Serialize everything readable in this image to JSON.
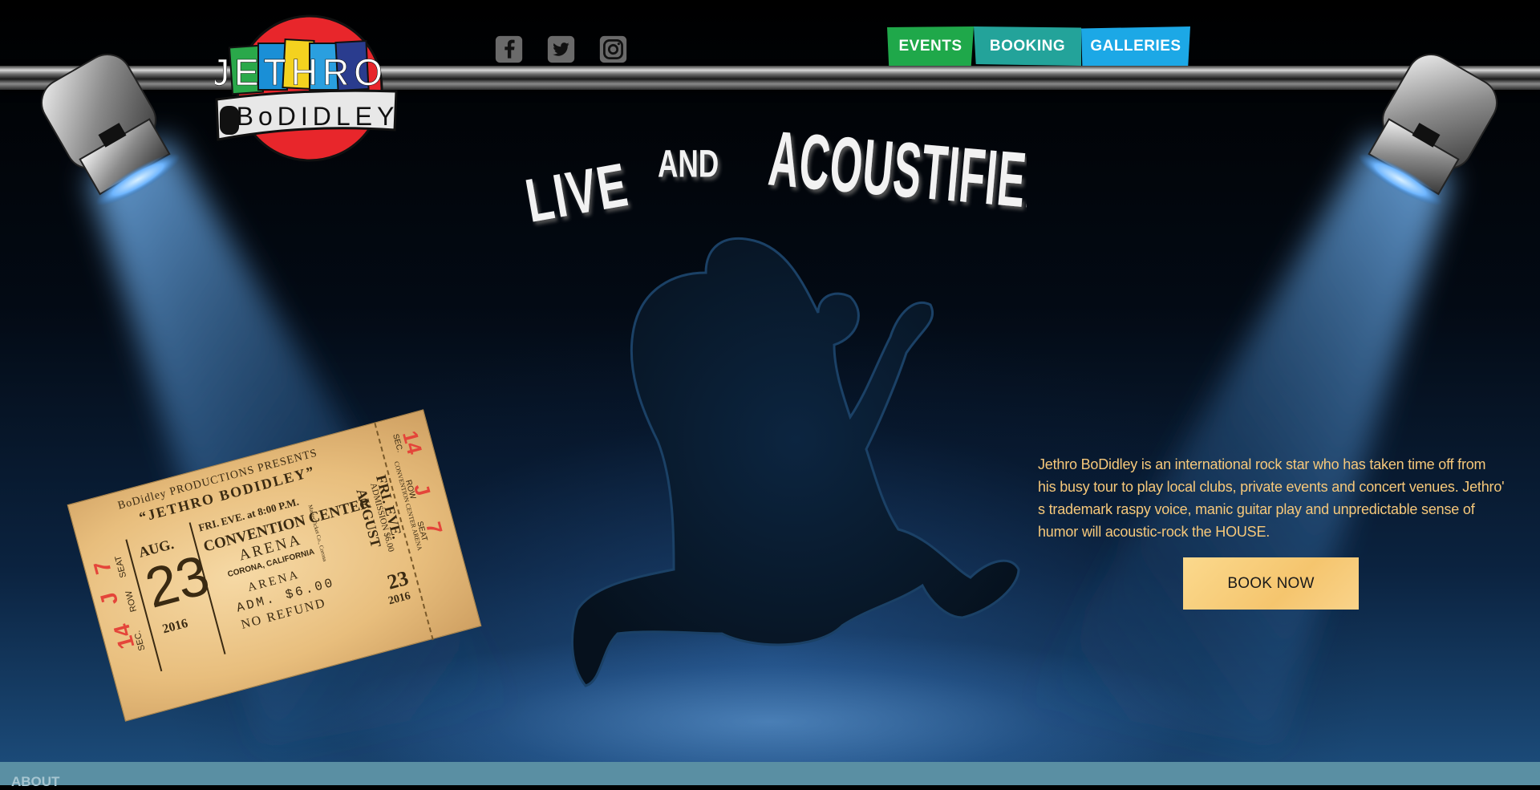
{
  "logo": {
    "line1": "JETHRO",
    "line2": "BoDIDLEY"
  },
  "social": [
    {
      "name": "facebook-icon"
    },
    {
      "name": "twitter-icon"
    },
    {
      "name": "instagram-icon"
    }
  ],
  "nav": {
    "events": "EVENTS",
    "booking": "BOOKING",
    "galleries": "GALLERIES"
  },
  "headline": {
    "word1": "LIVE",
    "word2": "AND",
    "word3": "ACOUSTIFIED!"
  },
  "ticket": {
    "presenter": "BoDidley PRODUCTIONS PRESENTS",
    "artist": "“JETHRO BODIDLEY”",
    "sec": "SEC.",
    "row": "ROW",
    "seat": "SEAT",
    "sec_no": "14",
    "row_no": "J",
    "seat_no": "7",
    "time": "FRI. EVE. at 8:00 P.M.",
    "venue": "CONVENTION CENTER",
    "arena": "ARENA",
    "city": "CORONA, CALIFORNIA",
    "month": "AUG.",
    "day": "23",
    "year": "2016",
    "stub_line": "ARENA",
    "adm": "ADM. $6.00",
    "refund": "NO REFUND",
    "stub_fri": "FRI. EVE.",
    "stub_month": "AUGUST",
    "stub_day": "23",
    "stub_year": "2016",
    "stub_admission": "ADMISSION $6.00",
    "stub_venue": "CONVENTION CENTER ARENA",
    "stub_master": "MasterTicket Co., Corona"
  },
  "intro_text": "Jethro BoDidley is an international rock star who has taken time off from his busy tour to play local clubs, private events and concert venues. Jethro' s trademark raspy voice, manic guitar play and unpredictable sense of humor will acoustic-rock the HOUSE.",
  "cta": {
    "label": "BOOK NOW"
  },
  "about": {
    "label": "ABOUT"
  },
  "colors": {
    "events": "#1fa84a",
    "booking": "#23a39a",
    "galleries": "#1ca8e6",
    "intro_text": "#f6c87a",
    "cta_bg": "#f5c56e",
    "about_bar": "#5a8fa3",
    "logo_red": "#e8262b"
  }
}
